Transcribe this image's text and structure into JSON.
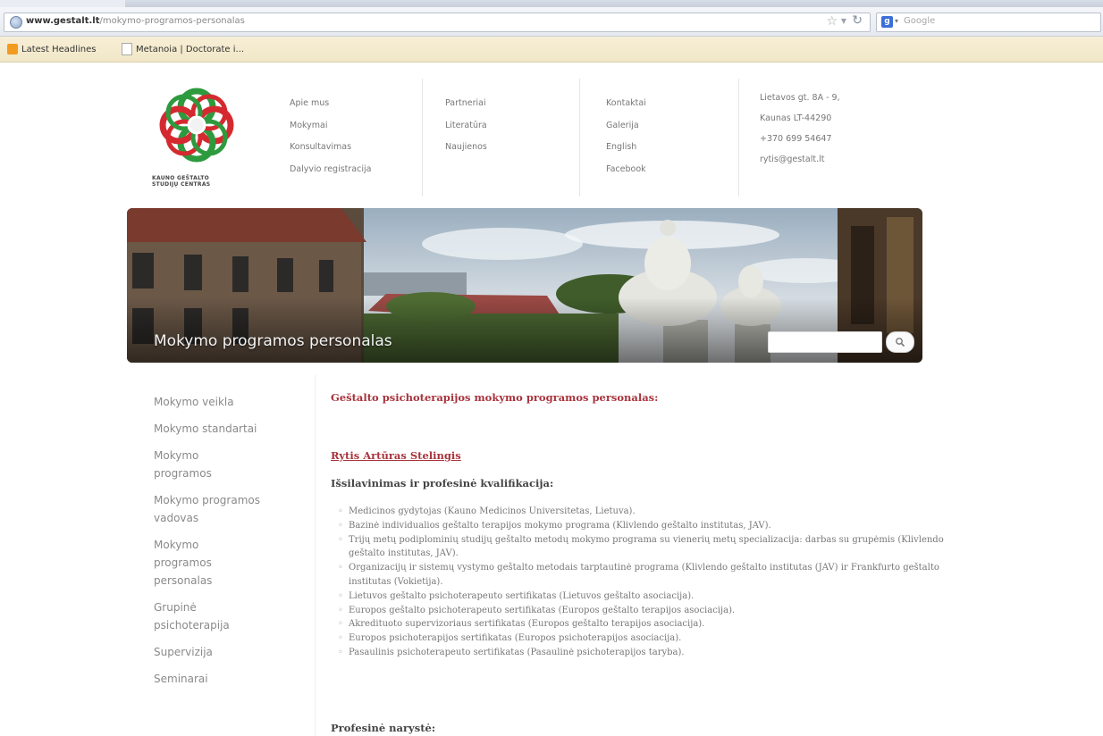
{
  "browser": {
    "url_domain": "www.gestalt.lt",
    "url_path": "/mokymo-programos-personalas",
    "search_placeholder": "Google",
    "bookmarks": [
      {
        "label": "Latest Headlines",
        "icon": "rss-icon"
      },
      {
        "label": "Metanoia | Doctorate i...",
        "icon": "page-icon"
      }
    ]
  },
  "logo": {
    "caption_line1": "KAUNO GEŠTALTO",
    "caption_line2": "STUDIJŲ CENTRAS"
  },
  "nav": {
    "col1": [
      "Apie mus",
      "Mokymai",
      "Konsultavimas",
      "Dalyvio registracija"
    ],
    "col2": [
      "Partneriai",
      "Literatūra",
      "Naujienos"
    ],
    "col3": [
      "Kontaktai",
      "Galerija",
      "English",
      "Facebook"
    ],
    "contact": [
      "Lietavos gt. 8A - 9,",
      "Kaunas LT-44290",
      "+370 699 54647",
      "rytis@gestalt.lt"
    ]
  },
  "hero": {
    "title": "Mokymo programos personalas",
    "search_value": ""
  },
  "sidebar": {
    "items": [
      "Mokymo veikla",
      "Mokymo standartai",
      "Mokymo programos",
      "Mokymo programos vadovas",
      "Mokymo programos personalas",
      "Grupinė psichoterapija",
      "Supervizija",
      "Seminarai"
    ]
  },
  "content": {
    "heading": "Geštalto psichoterapijos mokymo programos personalas:",
    "person": "Rytis Artūras Stelingis",
    "education_heading": "Išsilavinimas ir profesinė kvalifikacija:",
    "qualifications": [
      "Medicinos gydytojas (Kauno Medicinos Universitetas, Lietuva).",
      "Bazinė individualios geštalto terapijos mokymo programa (Klivlendo geštalto institutas, JAV).",
      "Trijų metų podiplominių studijų geštalto metodų mokymo programa su vienerių metų specializacija: darbas su grupėmis (Klivlendo geštalto institutas, JAV).",
      "Organizacijų ir sistemų vystymo geštalto metodais tarptautinė programa (Klivlendo geštalto institutas (JAV) ir Frankfurto geštalto institutas (Vokietija).",
      "Lietuvos geštalto psichoterapeuto sertifikatas (Lietuvos geštalto asociacija).",
      "Europos geštalto psichoterapeuto sertifikatas (Europos geštalto terapijos asociacija).",
      "Akredituoto supervizoriaus sertifikatas (Europos geštalto terapijos asociacija).",
      "Europos psichoterapijos sertifikatas (Europos psichoterapijos asociacija).",
      "Pasaulinis psichoterapeuto sertifikatas (Pasaulinė psichoterapijos taryba)."
    ],
    "membership_heading": "Profesinė narystė:"
  },
  "colors": {
    "accent": "#a8343d",
    "logo_green": "#2e9a3e",
    "logo_red": "#d42a2f"
  }
}
